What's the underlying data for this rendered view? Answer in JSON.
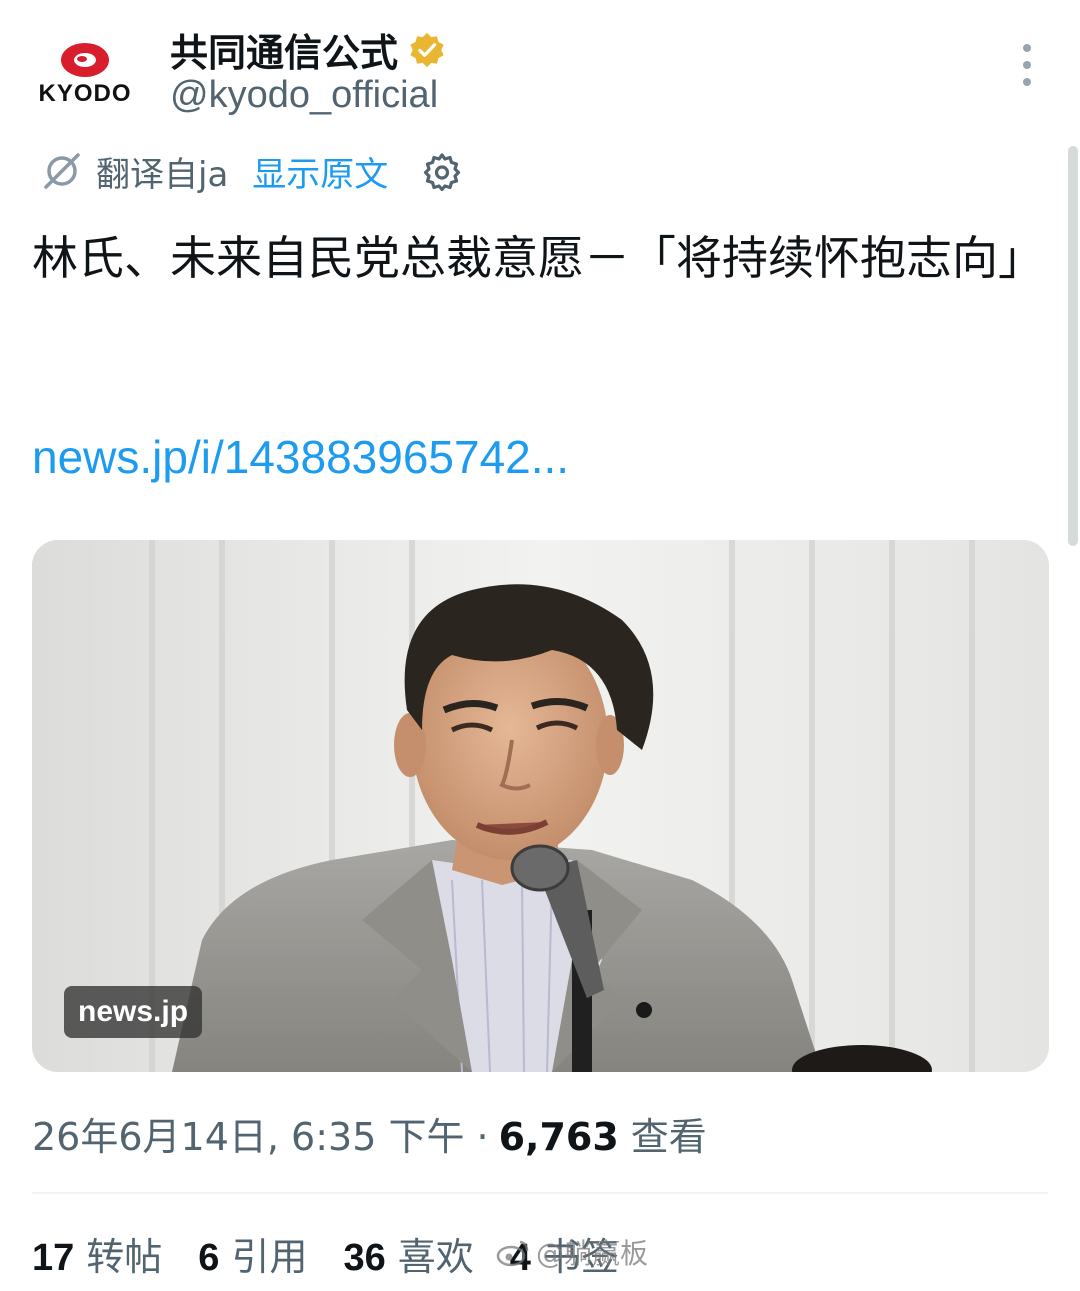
{
  "author": {
    "display_name": "共同通信公式",
    "handle": "@kyodo_official",
    "avatar_text": "KYODO",
    "verified": true
  },
  "translation": {
    "label": "翻译自ja",
    "show_original": "显示原文"
  },
  "tweet": {
    "text": "林氏、未来自民党总裁意愿－「将持续怀抱志向」",
    "link": "news.jp/i/143883965742..."
  },
  "media": {
    "source_badge": "news.jp"
  },
  "meta": {
    "timestamp": "26年6月14日, 6:35 下午",
    "separator": "·",
    "views_count": "6,763",
    "views_label": "查看"
  },
  "stats": {
    "reposts": {
      "count": "17",
      "label": "转帖"
    },
    "quotes": {
      "count": "6",
      "label": "引用"
    },
    "likes": {
      "count": "36",
      "label": "喜欢"
    },
    "bookmarks": {
      "count": "4",
      "label": "书签"
    }
  },
  "watermark": "@躺赢板",
  "colors": {
    "accent": "#1d9bf0",
    "verified_badge": "#e8b630",
    "kyodo_red": "#d81e2c",
    "secondary_text": "#536471"
  }
}
